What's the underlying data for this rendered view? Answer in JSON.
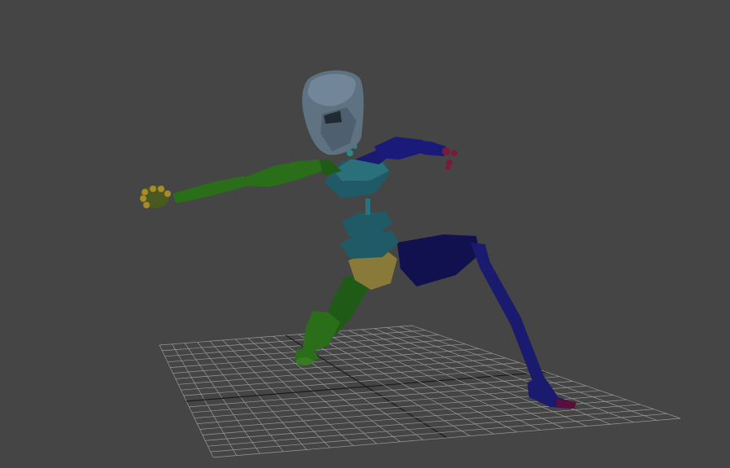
{
  "viewport": {
    "background": "#454545"
  },
  "grid": {
    "line_color": "#9a9a9a",
    "axis_color": "#1a1a1a"
  },
  "biped": {
    "colors": {
      "head": "#5f7282",
      "left_arm": "#2a6e1a",
      "left_hand": "#a88a2a",
      "right_arm": "#1a1a7a",
      "right_hand": "#7a1a3a",
      "spine": "#1f5a66",
      "pelvis": "#8a7a3a",
      "left_leg": "#2a6e1a",
      "right_leg": "#14145a",
      "right_foot": "#5a0f3a"
    }
  }
}
